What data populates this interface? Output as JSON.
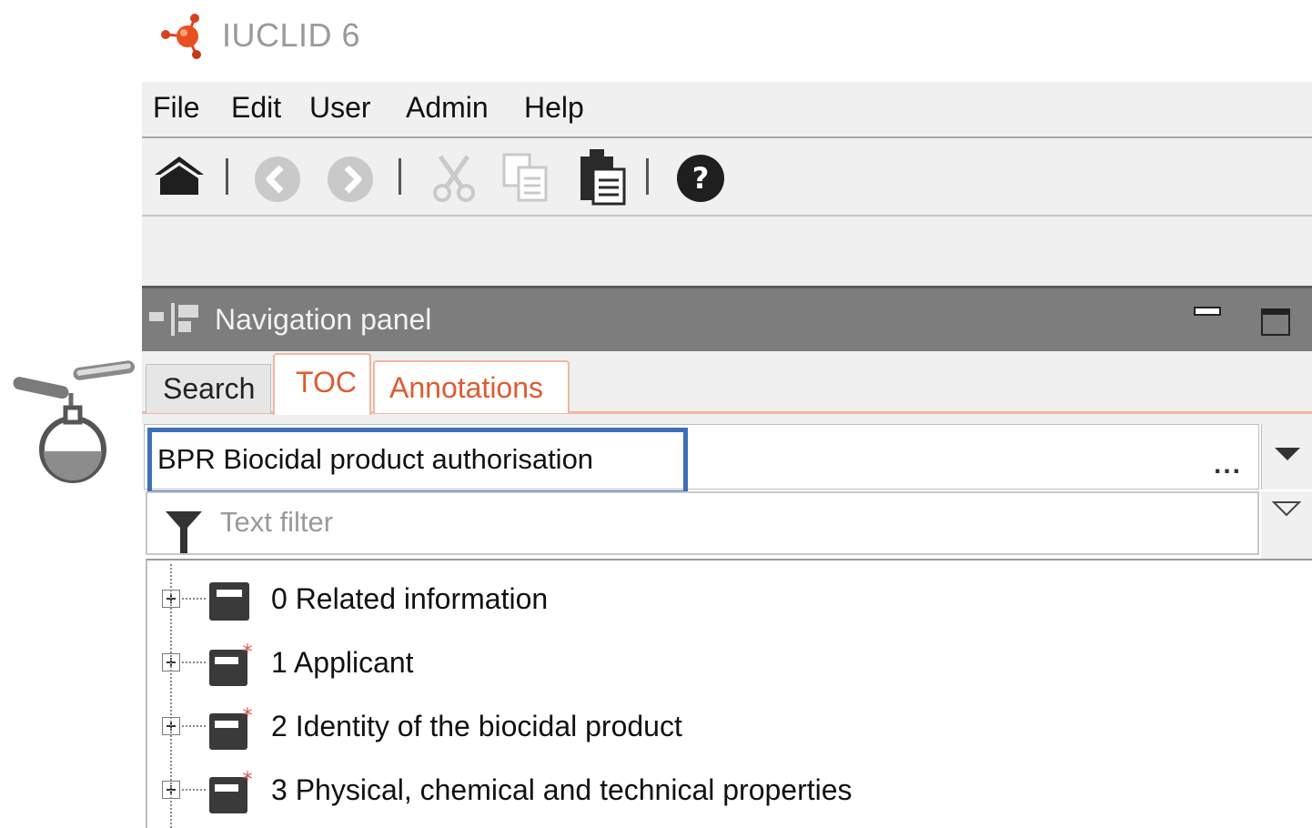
{
  "app": {
    "title": "IUCLID 6",
    "logo_icon": "iuclid-molecule-logo-icon"
  },
  "menu": [
    "File",
    "Edit",
    "User",
    "Admin",
    "Help"
  ],
  "toolbar": {
    "icons": [
      "home-icon",
      "back-icon",
      "forward-icon",
      "cut-icon",
      "copy-icon",
      "paste-icon",
      "help-icon"
    ]
  },
  "navigation_panel": {
    "title": "Navigation panel",
    "tabs": [
      {
        "label": "Search",
        "active": false
      },
      {
        "label": "TOC",
        "active": true
      },
      {
        "label": "Annotations",
        "active": false
      }
    ],
    "template": {
      "value": "BPR Biocidal product authorisation",
      "ellipsis": "..."
    },
    "filter": {
      "placeholder": "Text filter"
    },
    "tree": [
      {
        "label": "0 Related information",
        "required": false
      },
      {
        "label": "1 Applicant",
        "required": true
      },
      {
        "label": "2 Identity of the biocidal product",
        "required": true
      },
      {
        "label": "3 Physical, chemical and technical properties",
        "required": true
      }
    ]
  },
  "colors": {
    "accent_tab": "#e05a30",
    "highlight_box": "#3d6fba",
    "panel_header": "#7d7d7d",
    "required_star": "#d9534f"
  }
}
